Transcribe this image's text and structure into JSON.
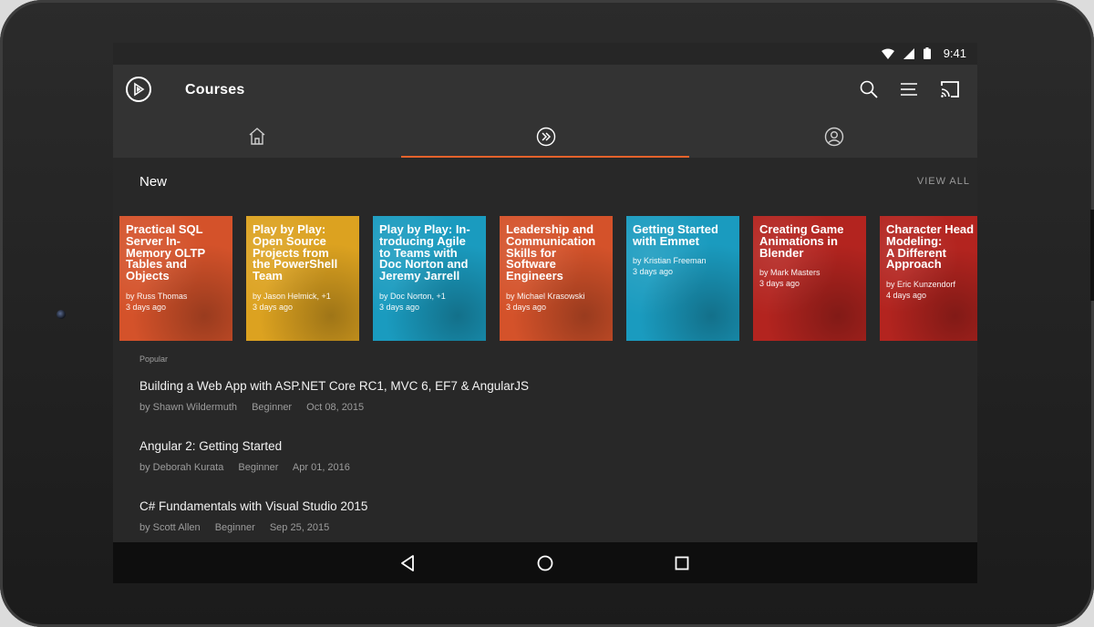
{
  "status": {
    "time": "9:41"
  },
  "appbar": {
    "title": "Courses"
  },
  "tabs": [
    {
      "name": "home",
      "icon": "home-icon"
    },
    {
      "name": "courses",
      "icon": "double-chevron-right-icon",
      "selected": true
    },
    {
      "name": "profile",
      "icon": "user-circle-icon"
    }
  ],
  "colors": {
    "accent": "#e9622b",
    "orange": "#d5522a",
    "yellow": "#dca220",
    "teal": "#1a9bbf",
    "red": "#b3241f"
  },
  "new_section": {
    "title": "New",
    "view_all": "VIEW ALL",
    "cards": [
      {
        "title": "Practical SQL Server In-Memory OLTP Tables and Objects",
        "author": "by Russ Thomas",
        "age": "3 days ago",
        "color": "#d4522a"
      },
      {
        "title": "Play by Play: Open Source Projects from the PowerShell Team",
        "author": "by Jason Helmick, +1",
        "age": "3 days ago",
        "color": "#dca220"
      },
      {
        "title": "Play by Play: Introducing Agile to Teams with Doc Norton and Jeremy Jarrell",
        "author": "by Doc Norton, +1",
        "age": "3 days ago",
        "color": "#1a9bbf"
      },
      {
        "title": "Leadership and Communication Skills for Software Engineers",
        "author": "by Michael Krasowski",
        "age": "3 days ago",
        "color": "#d4522a"
      },
      {
        "title": "Getting Started with Emmet",
        "author": "by Kristian Freeman",
        "age": "3 days ago",
        "color": "#1a9bbf"
      },
      {
        "title": "Creating Game Animations in Blender",
        "author": "by Mark Masters",
        "age": "3 days ago",
        "color": "#b3241f"
      },
      {
        "title": "Character Head Modeling: A Different Approach",
        "author": "by Eric Kunzendorf",
        "age": "4 days ago",
        "color": "#b3241f"
      }
    ],
    "card_titles_display": [
      "Practical SQL\nServer In-\nMemory OLTP\nTables and\nObjects",
      "Play by Play:\nOpen Source\nProjects from\nthe PowerShell\nTeam",
      "Play by Play: In-\ntroducing Agile\nto Teams with\nDoc Norton and\nJeremy Jarrell",
      "Leadership and\nCommunication\nSkills for\nSoftware\nEngineers",
      "Getting Started\nwith Emmet",
      "Creating Game\nAnimations in\nBlender",
      "Character Head\nModeling:\nA Different\nApproach"
    ]
  },
  "popular": {
    "label": "Popular",
    "courses": [
      {
        "title": "Building a Web App with ASP.NET Core RC1, MVC 6, EF7 & AngularJS",
        "author": "by Shawn Wildermuth",
        "level": "Beginner",
        "date": "Oct 08, 2015"
      },
      {
        "title": "Angular 2: Getting Started",
        "author": "by Deborah Kurata",
        "level": "Beginner",
        "date": "Apr 01, 2016"
      },
      {
        "title": "C# Fundamentals with Visual Studio 2015",
        "author": "by Scott Allen",
        "level": "Beginner",
        "date": "Sep 25, 2015"
      }
    ]
  }
}
